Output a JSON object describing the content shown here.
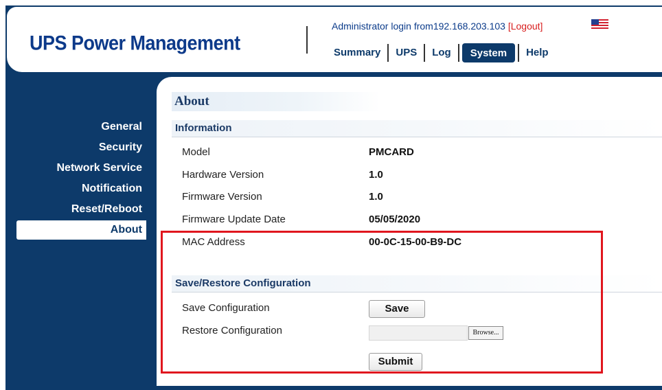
{
  "header": {
    "brand": "UPS Power Management",
    "login_prefix": "Administrator login from",
    "login_ip": "192.168.203.103",
    "logout_label": "[Logout]",
    "flag_icon": "us-flag-icon"
  },
  "nav": {
    "tabs": [
      {
        "label": "Summary"
      },
      {
        "label": "UPS"
      },
      {
        "label": "Log"
      },
      {
        "label": "System"
      },
      {
        "label": "Help"
      }
    ],
    "active": "System"
  },
  "sidebar": {
    "items": [
      {
        "label": "General"
      },
      {
        "label": "Security"
      },
      {
        "label": "Network Service"
      },
      {
        "label": "Notification"
      },
      {
        "label": "Reset/Reboot"
      },
      {
        "label": "About"
      }
    ],
    "active": "About"
  },
  "content": {
    "title": "About",
    "information": {
      "heading": "Information",
      "rows": [
        {
          "label": "Model",
          "value": "PMCARD"
        },
        {
          "label": "Hardware Version",
          "value": "1.0"
        },
        {
          "label": "Firmware Version",
          "value": "1.0"
        },
        {
          "label": "Firmware Update Date",
          "value": "05/05/2020"
        },
        {
          "label": "MAC Address",
          "value": "00-0C-15-00-B9-DC"
        }
      ]
    },
    "config": {
      "heading": "Save/Restore Configuration",
      "save_label": "Save Configuration",
      "save_button": "Save",
      "restore_label": "Restore Configuration",
      "browse_button": "Browse...",
      "file_value": "",
      "submit_button": "Submit"
    }
  },
  "colors": {
    "navy": "#0d3a6a",
    "brand": "#0d3a8a",
    "logout": "#d81e1e",
    "highlight": "#e0161e"
  }
}
